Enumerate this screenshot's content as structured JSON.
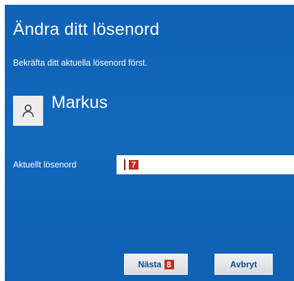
{
  "dialog": {
    "title": "Ändra ditt lösenord",
    "subtitle": "Bekräfta ditt aktuella lösenord först."
  },
  "user": {
    "name": "Markus",
    "avatar_icon": "user-icon"
  },
  "password_field": {
    "label": "Aktuellt lösenord",
    "value": "",
    "annotation_badge": "7"
  },
  "buttons": {
    "next_label": "Nästa",
    "next_badge": "8",
    "cancel_label": "Avbryt"
  },
  "colors": {
    "dialog_background": "#0f63b8",
    "badge": "#c62a1f",
    "button_text": "#0d4f96"
  }
}
